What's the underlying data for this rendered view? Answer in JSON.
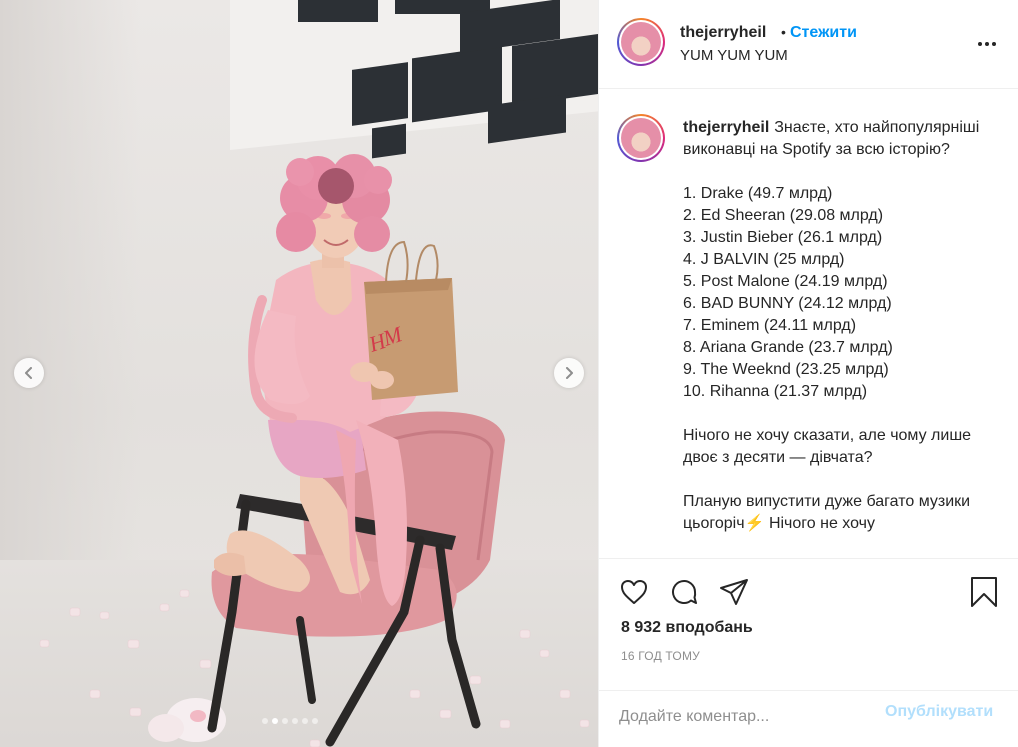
{
  "post": {
    "username": "thejerryheil",
    "dot": "•",
    "follow_label": "Стежити",
    "location": "YUM YUM YUM"
  },
  "caption": {
    "username": "thejerryheil",
    "lines": [
      "Знаєте, хто найпопулярніші виконавці на Spotify за всю історію?",
      "",
      "1. Drake (49.7 млрд)",
      "2. Ed Sheeran (29.08 млрд)",
      "3. Justin Bieber (26.1 млрд)",
      "4. J BALVIN (25 млрд)",
      "5. Post Malone (24.19 млрд)",
      "6. BAD BUNNY (24.12 млрд)",
      "7. Eminem (24.11 млрд)",
      "8. Ariana Grande (23.7 млрд)",
      "9. The Weeknd (23.25 млрд)",
      "10. Rihanna (21.37 млрд)",
      "",
      "Нічого не хочу сказати, але чому лише двоє з десяти — дівчата?",
      "",
      "Планую випустити дуже багато музики цьогоріч⚡ Нічого не хочу"
    ]
  },
  "stats": {
    "likes": "8 932 вподобань",
    "time_ago": "16 ГОД ТОМУ"
  },
  "comment_box": {
    "placeholder": "Додайте коментар...",
    "post_label": "Опублікувати"
  },
  "carousel": {
    "slide_count": 6,
    "active_index": 1
  },
  "colors": {
    "accent": "#0095f6",
    "post_disabled": "#b2dffc",
    "text": "#262626",
    "muted": "#8e8e8e"
  }
}
